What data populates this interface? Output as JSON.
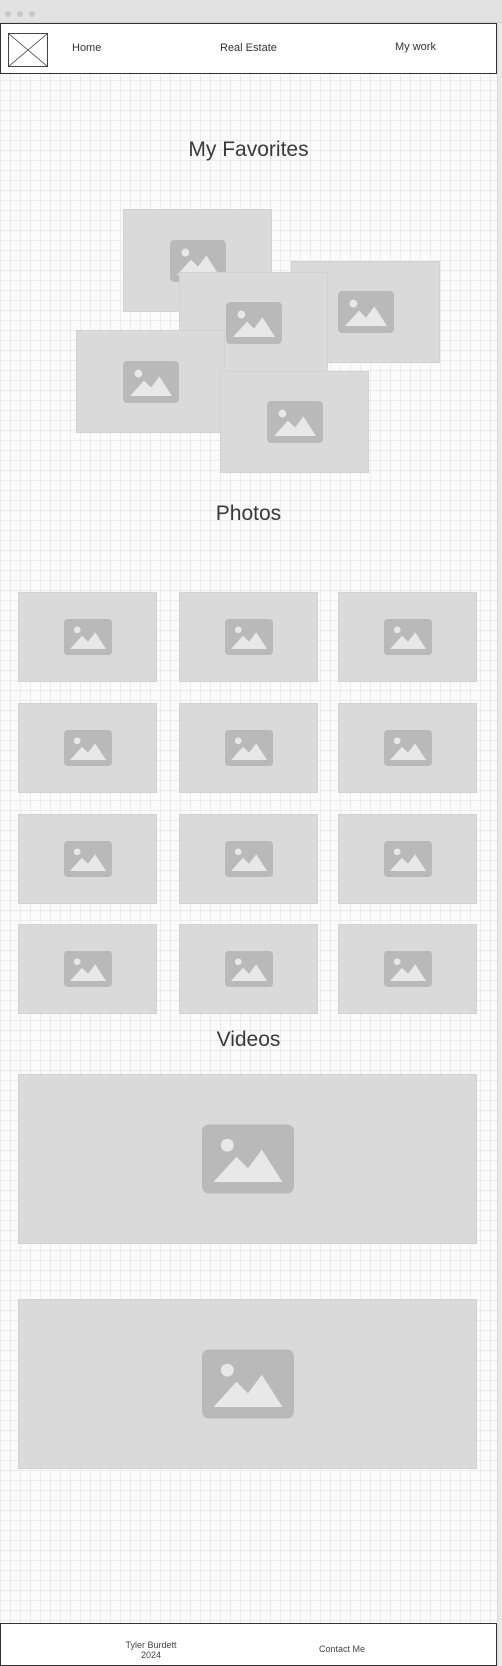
{
  "nav": {
    "logo_icon": "image-placeholder-icon",
    "links": [
      "Home",
      "Real Estate",
      "My work"
    ]
  },
  "sections": {
    "favorites_title": "My Favorites",
    "photos_title": "Photos",
    "videos_title": "Videos"
  },
  "footer": {
    "name": "Tyler Burdett",
    "year": "2024",
    "contact": "Contact Me"
  },
  "colors": {
    "placeholder": "#dadada",
    "placeholder_icon": "#b9b9b9",
    "bar_border": "#333333"
  }
}
